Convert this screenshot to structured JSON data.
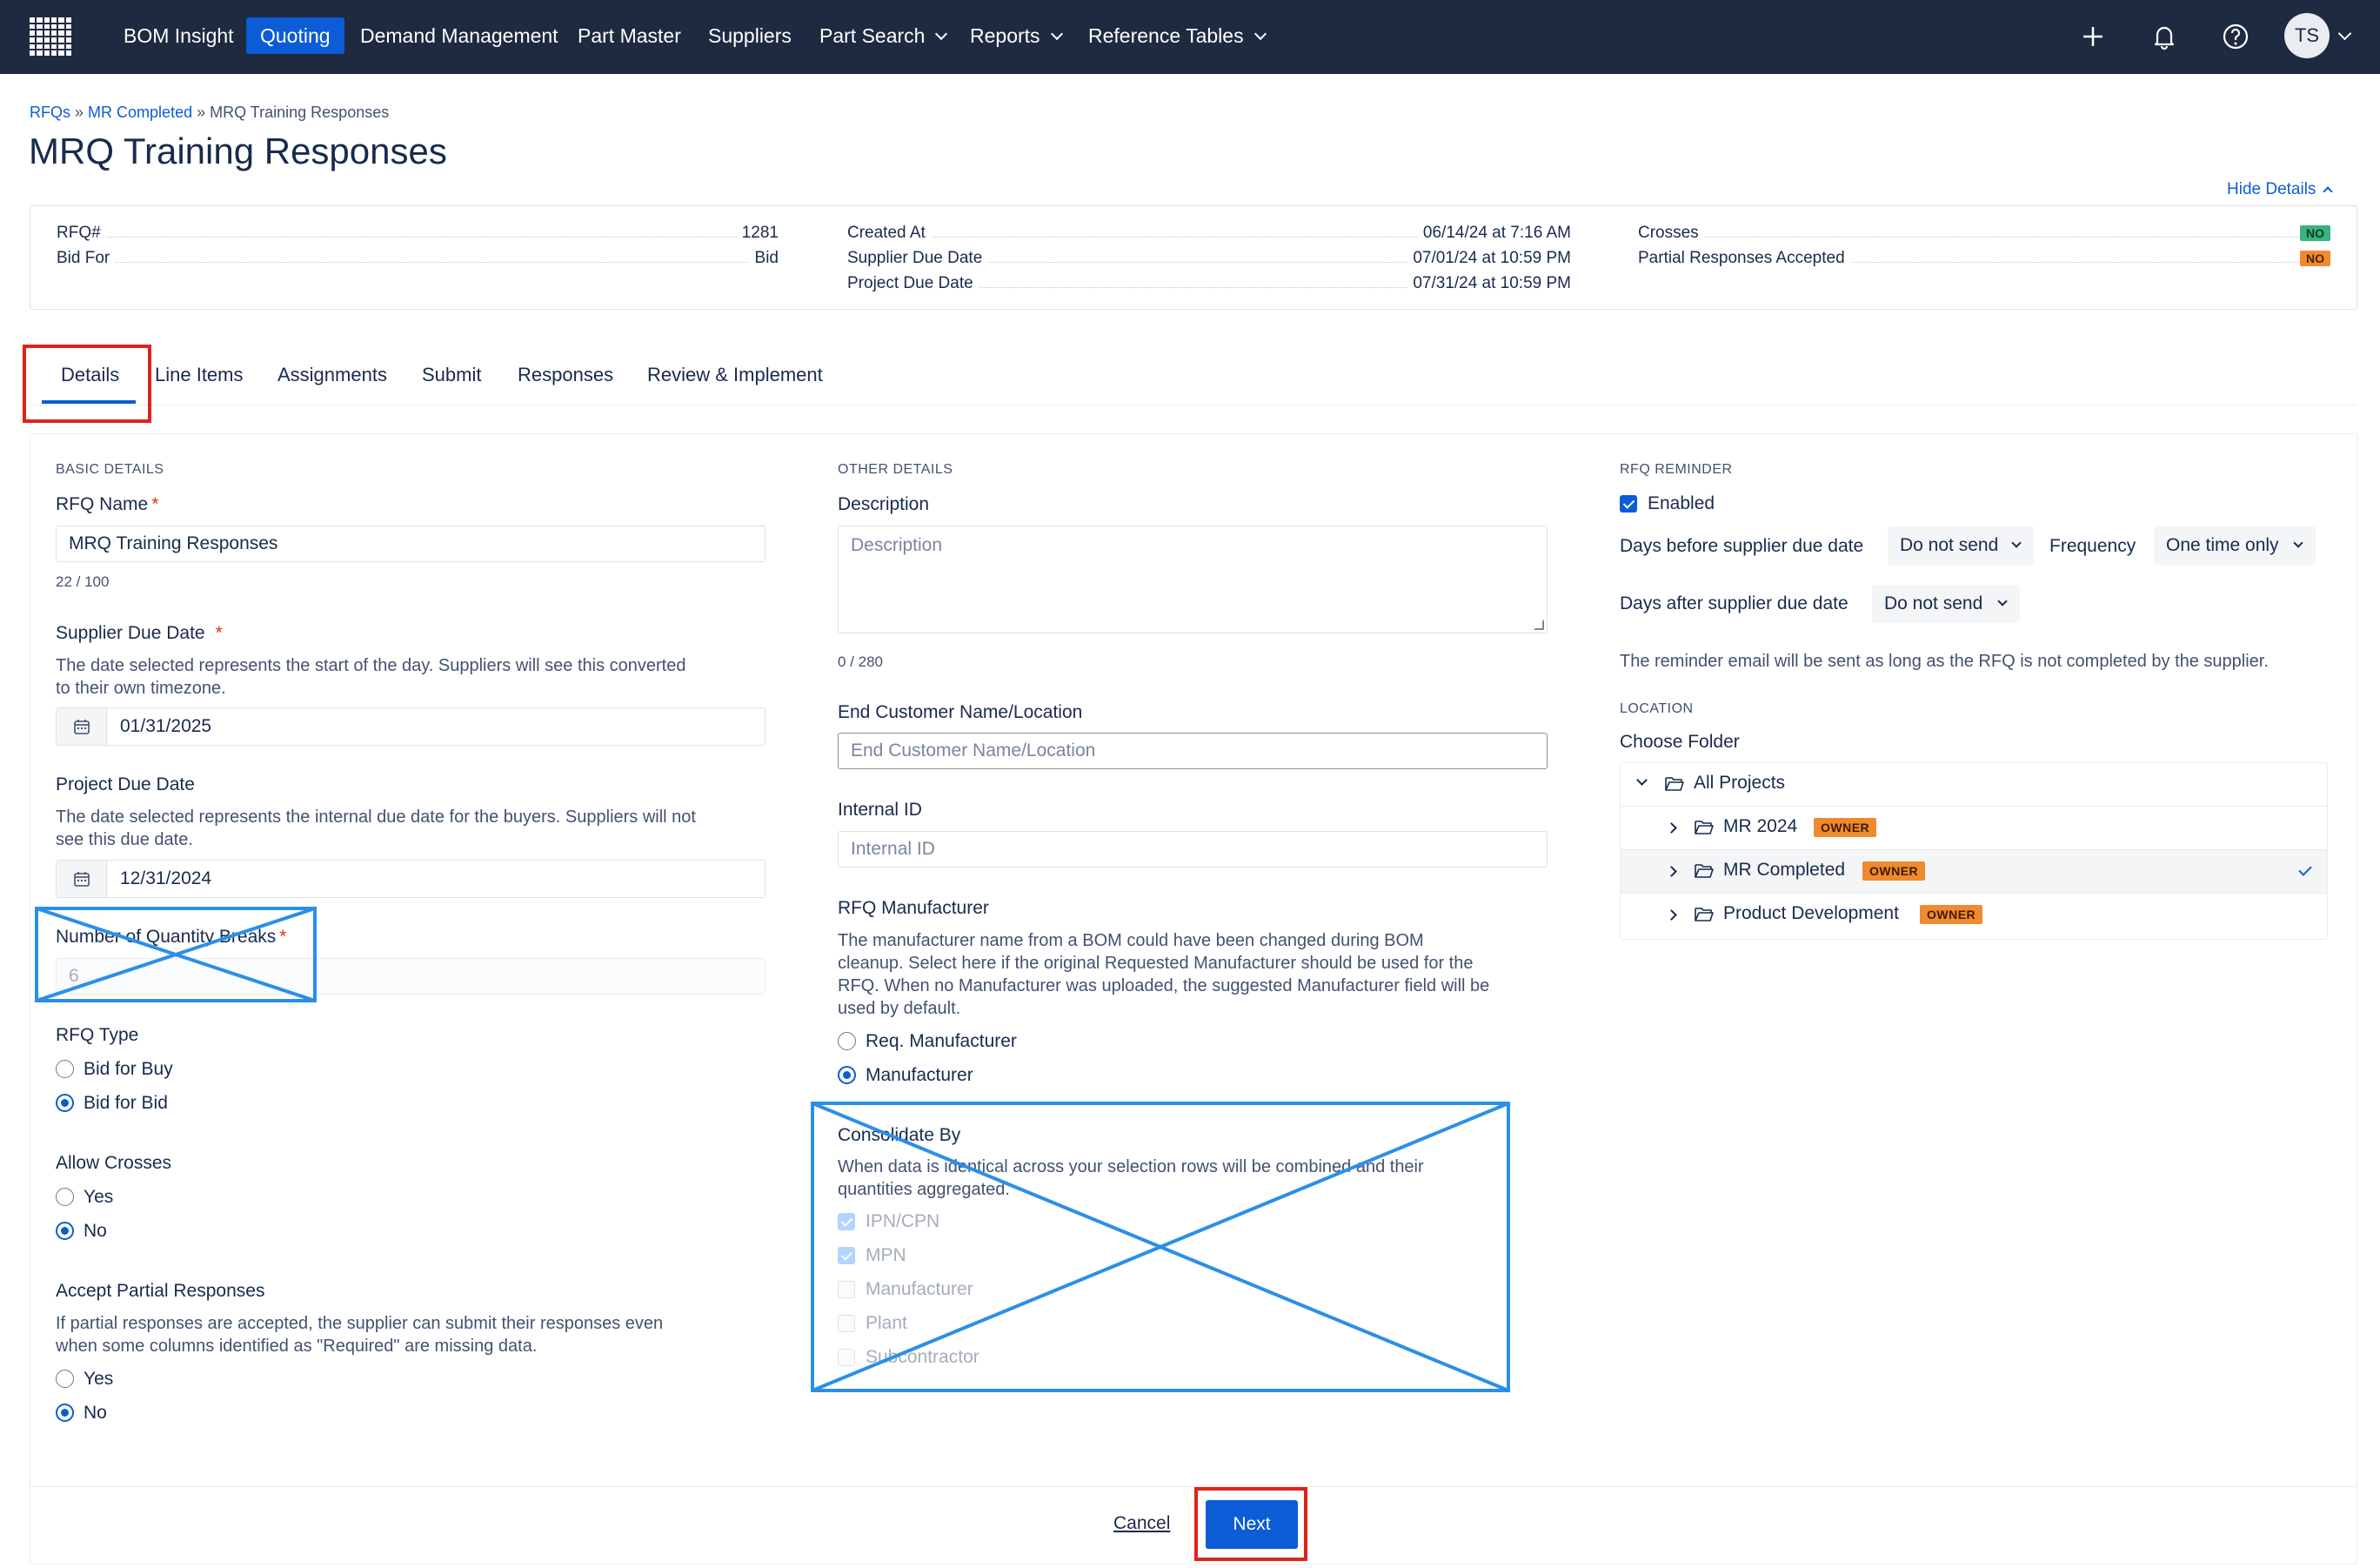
{
  "nav": {
    "items": [
      {
        "label": "BOM Insight"
      },
      {
        "label": "Quoting",
        "active": true
      },
      {
        "label": "Demand Management"
      },
      {
        "label": "Part Master"
      },
      {
        "label": "Suppliers"
      },
      {
        "label": "Part Search",
        "dropdown": true
      },
      {
        "label": "Reports",
        "dropdown": true
      },
      {
        "label": "Reference Tables",
        "dropdown": true
      }
    ],
    "icons": [
      "plus-icon",
      "bell-icon",
      "help-icon"
    ],
    "avatar_initials": "TS"
  },
  "breadcrumb": {
    "items": [
      "RFQs",
      "MR Completed",
      "MRQ Training Responses"
    ],
    "separator": "»"
  },
  "page_title": "MRQ Training Responses",
  "hide_details": "Hide Details",
  "summary": {
    "rfq_label": "RFQ#",
    "rfq_value": "1281",
    "bid_for_label": "Bid For",
    "bid_for_value": "Bid",
    "created_label": "Created At",
    "created_value": "06/14/24 at 7:16 AM",
    "supplier_due_label": "Supplier Due Date",
    "supplier_due_value": "07/01/24 at 10:59 PM",
    "project_due_label": "Project Due Date",
    "project_due_value": "07/31/24 at 10:59 PM",
    "crosses_label": "Crosses",
    "crosses_value": "NO",
    "partial_label": "Partial Responses Accepted",
    "partial_value": "NO"
  },
  "tabs": [
    "Details",
    "Line Items",
    "Assignments",
    "Submit",
    "Responses",
    "Review & Implement"
  ],
  "basic": {
    "section": "BASIC DETAILS",
    "rfq_name_label": "RFQ Name",
    "rfq_name_value": "MRQ Training Responses",
    "rfq_name_counter": "22 / 100",
    "supplier_due_label": "Supplier Due Date",
    "supplier_due_help_1": "The date selected represents the start of the day. Suppliers will see this converted",
    "supplier_due_help_2": "to their own timezone.",
    "supplier_due_value": "01/31/2025",
    "project_due_label": "Project Due Date",
    "project_due_help_1": "The date selected represents the internal due date for the buyers. Suppliers will not",
    "project_due_help_2": "see this due date.",
    "project_due_value": "12/31/2024",
    "qty_breaks_label": "Number of Quantity Breaks",
    "qty_breaks_value": "6",
    "rfq_type_label": "RFQ Type",
    "rfq_type_options": [
      "Bid for Buy",
      "Bid for Bid"
    ],
    "rfq_type_selected": "Bid for Bid",
    "crosses_label": "Allow Crosses",
    "crosses_options": [
      "Yes",
      "No"
    ],
    "crosses_selected": "No",
    "partial_label": "Accept Partial Responses",
    "partial_help_1": "If partial responses are accepted, the supplier can submit their responses even",
    "partial_help_2": "when some columns identified as \"Required\" are missing data.",
    "partial_options": [
      "Yes",
      "No"
    ],
    "partial_selected": "No"
  },
  "other": {
    "section": "OTHER DETAILS",
    "description_label": "Description",
    "description_placeholder": "Description",
    "description_counter": "0 / 280",
    "end_customer_label": "End Customer Name/Location",
    "end_customer_placeholder": "End Customer Name/Location",
    "internal_id_label": "Internal ID",
    "internal_id_placeholder": "Internal ID",
    "manufacturer_label": "RFQ Manufacturer",
    "manufacturer_help_1": "The manufacturer name from a BOM could have been changed during BOM",
    "manufacturer_help_2": "cleanup. Select here if the original Requested Manufacturer should be used for the",
    "manufacturer_help_3": "RFQ. When no Manufacturer was uploaded, the suggested Manufacturer field will be",
    "manufacturer_help_4": "used by default.",
    "manufacturer_options": [
      "Req. Manufacturer",
      "Manufacturer"
    ],
    "manufacturer_selected": "Manufacturer",
    "consolidate_label": "Consolidate By",
    "consolidate_help_1": "When data is identical across your selection rows will be combined and their",
    "consolidate_help_2": "quantities aggregated.",
    "consolidate_options": [
      {
        "label": "IPN/CPN",
        "checked": true
      },
      {
        "label": "MPN",
        "checked": true
      },
      {
        "label": "Manufacturer",
        "checked": false
      },
      {
        "label": "Plant",
        "checked": false
      },
      {
        "label": "Subcontractor",
        "checked": false
      }
    ]
  },
  "reminder": {
    "section": "RFQ REMINDER",
    "enabled_label": "Enabled",
    "enabled": true,
    "before_label": "Days before supplier due date",
    "before_value": "Do not send",
    "frequency_label": "Frequency",
    "frequency_value": "One time only",
    "after_label": "Days after supplier due date",
    "after_value": "Do not send",
    "note": "The reminder email will be sent as long as the RFQ is not completed by the supplier."
  },
  "location": {
    "section": "LOCATION",
    "choose_label": "Choose Folder",
    "root": "All Projects",
    "folders": [
      {
        "name": "MR 2024",
        "badge": "OWNER",
        "selected": false
      },
      {
        "name": "MR Completed",
        "badge": "OWNER",
        "selected": true
      },
      {
        "name": "Product Development",
        "badge": "OWNER",
        "selected": false
      }
    ]
  },
  "footer": {
    "cancel": "Cancel",
    "next": "Next"
  },
  "colors": {
    "nav_bg": "#1e2a40",
    "accent": "#0b5cd6",
    "owner_badge": "#f08a2f",
    "no_flag_green": "#36b37e",
    "no_flag_orange": "#f08a2f",
    "highlight_red": "#e0231a",
    "annotation_blue": "#2b8fe8"
  }
}
